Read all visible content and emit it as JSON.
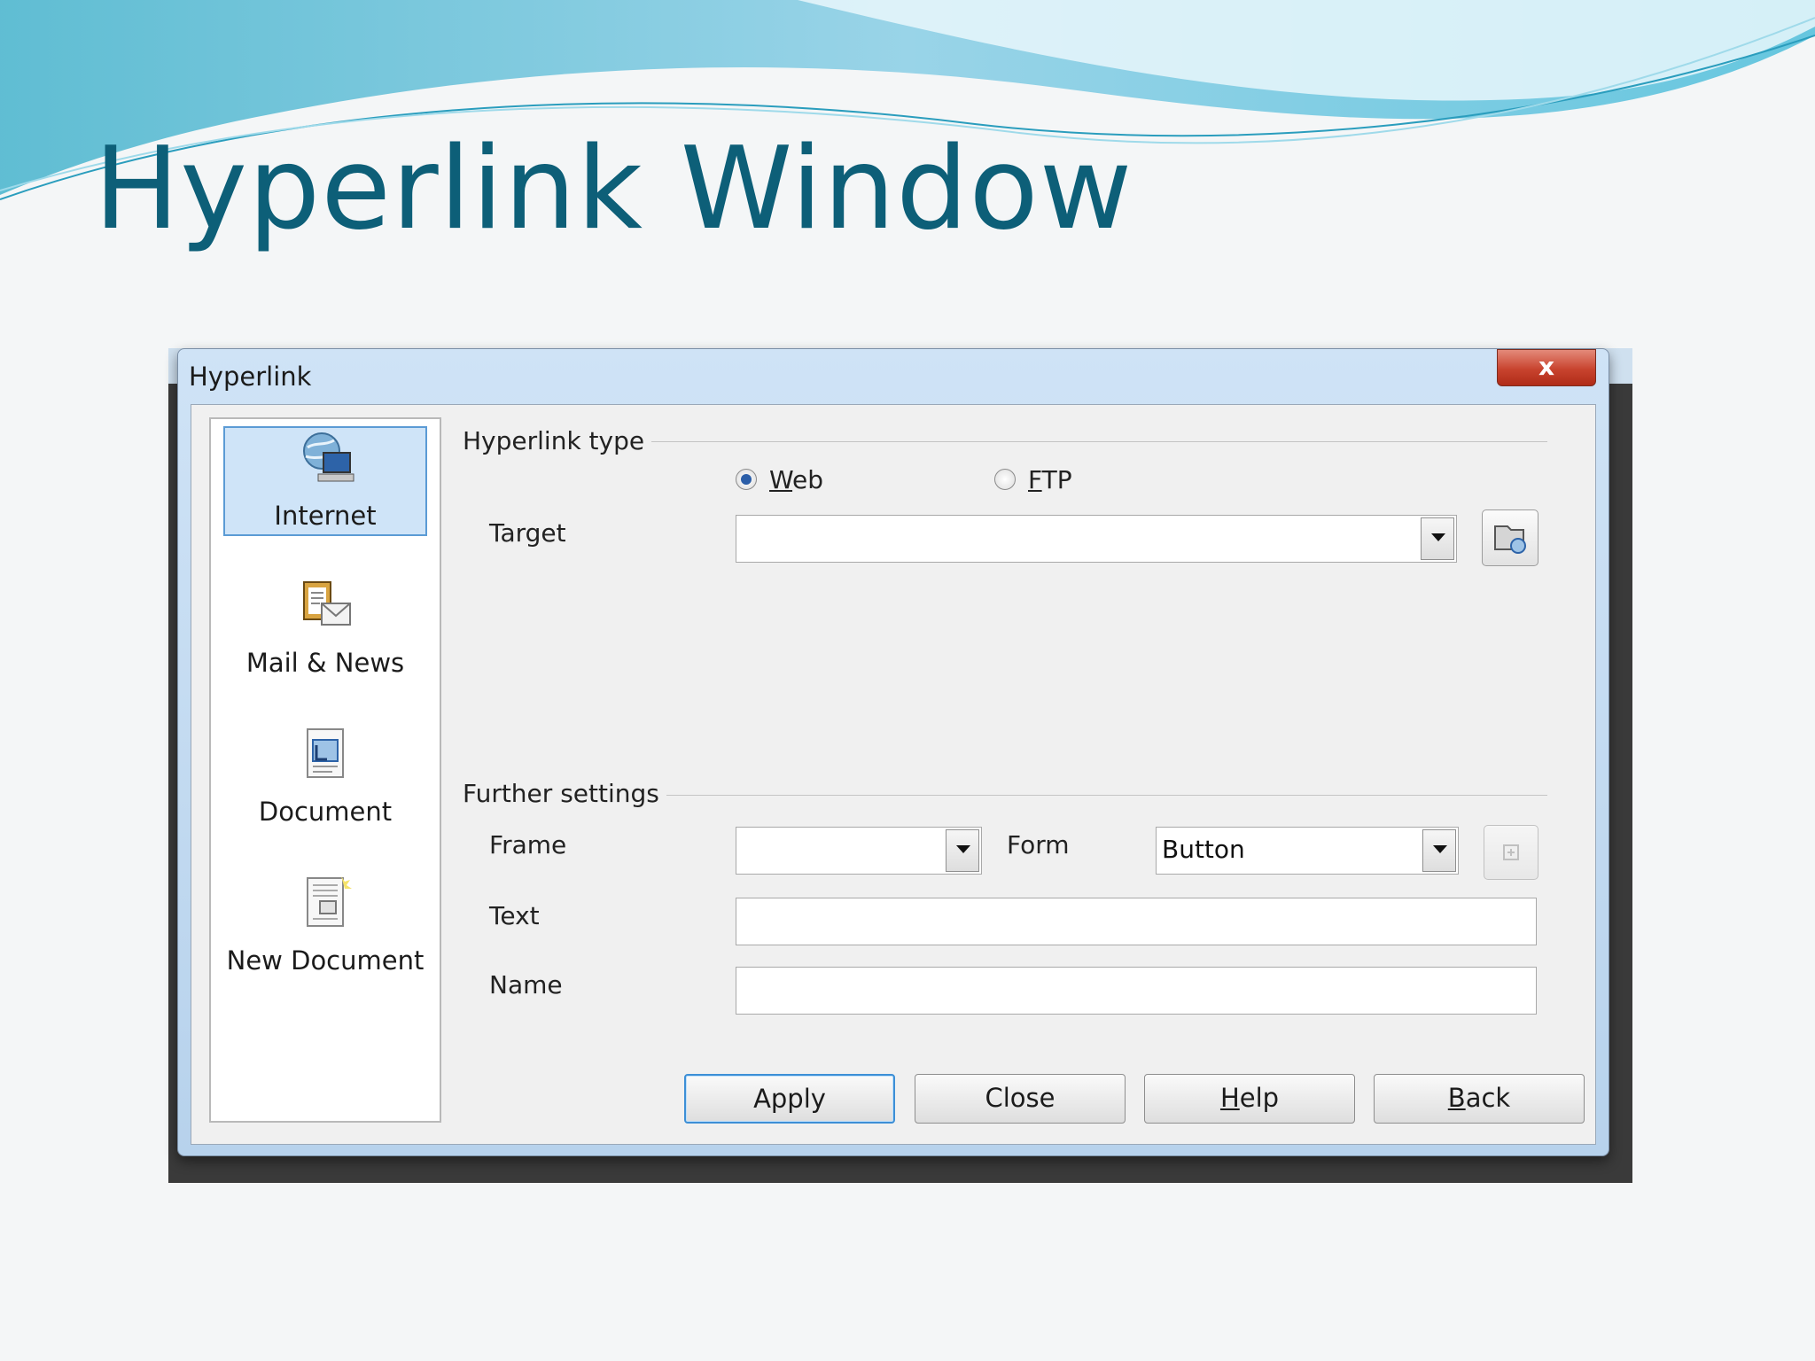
{
  "slide": {
    "title": "Hyperlink Window"
  },
  "dialog": {
    "title": "Hyperlink",
    "close_glyph": "x",
    "sidebar": [
      {
        "label": "Internet",
        "icon": "globe-computer-icon",
        "selected": true
      },
      {
        "label": "Mail & News",
        "icon": "mail-news-icon",
        "selected": false
      },
      {
        "label": "Document",
        "icon": "document-icon",
        "selected": false
      },
      {
        "label": "New Document",
        "icon": "new-document-icon",
        "selected": false
      }
    ],
    "hyperlink_type": {
      "group_label": "Hyperlink type",
      "options": [
        {
          "label": "Web",
          "mnemonic": "W",
          "selected": true
        },
        {
          "label": "FTP",
          "mnemonic": "F",
          "selected": false
        }
      ],
      "target_label": "Target",
      "target_value": ""
    },
    "further_settings": {
      "group_label": "Further settings",
      "frame_label": "Frame",
      "frame_value": "",
      "form_label": "Form",
      "form_value": "Button",
      "text_label": "Text",
      "text_value": "",
      "name_label": "Name",
      "name_value": ""
    },
    "buttons": {
      "apply": "Apply",
      "close": "Close",
      "help": "Help",
      "back": "Back"
    }
  }
}
